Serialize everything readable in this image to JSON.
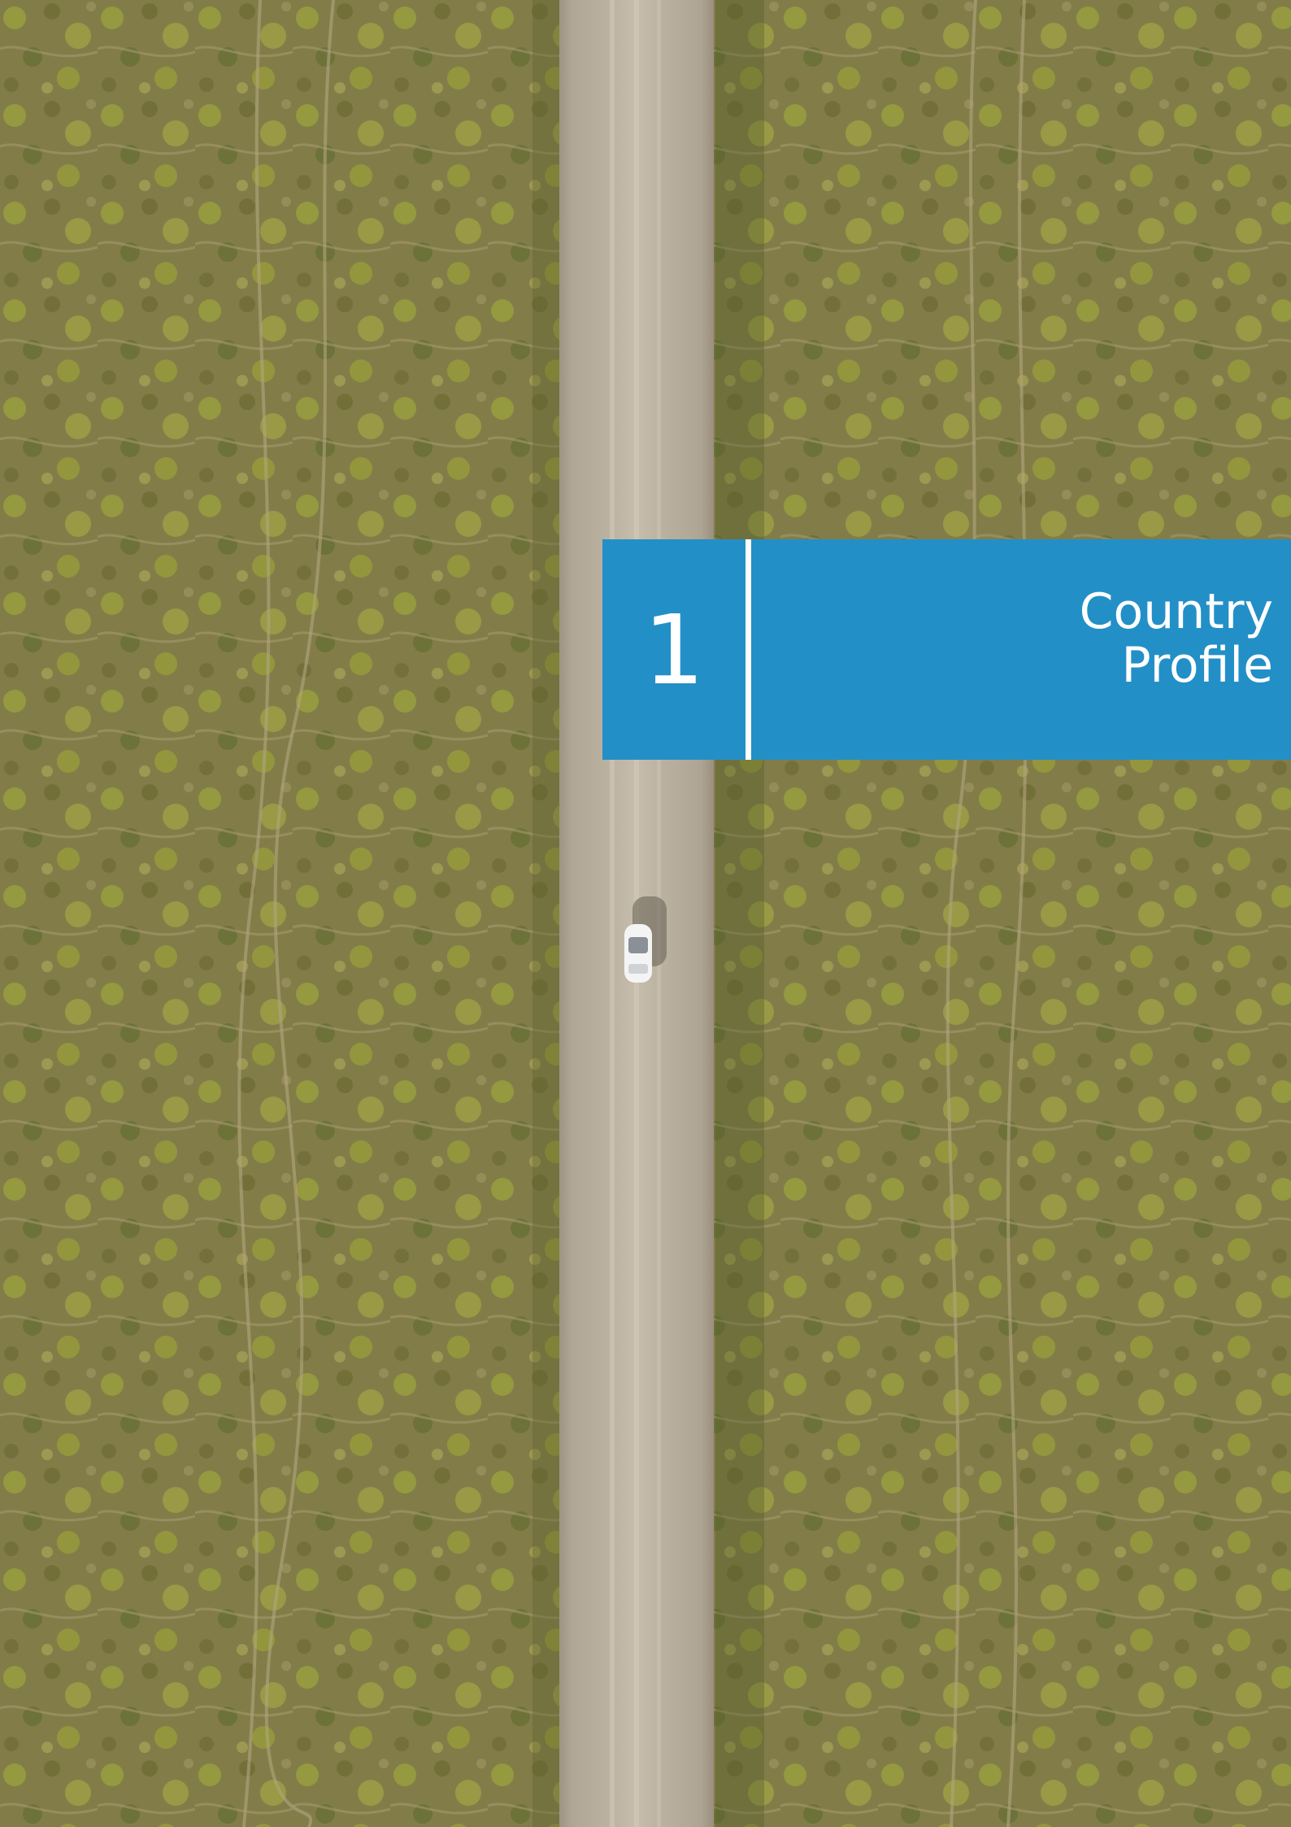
{
  "cover": {
    "chapter_number": "1",
    "title_lines": [
      "Country",
      "Profile"
    ],
    "photo": {
      "description_icon": "aerial-road-photo",
      "road_color": "#b1a795",
      "vegetation_color": "#7f7c45",
      "car_color": "#f4f4f4"
    },
    "banner_color": "#238fc7"
  }
}
